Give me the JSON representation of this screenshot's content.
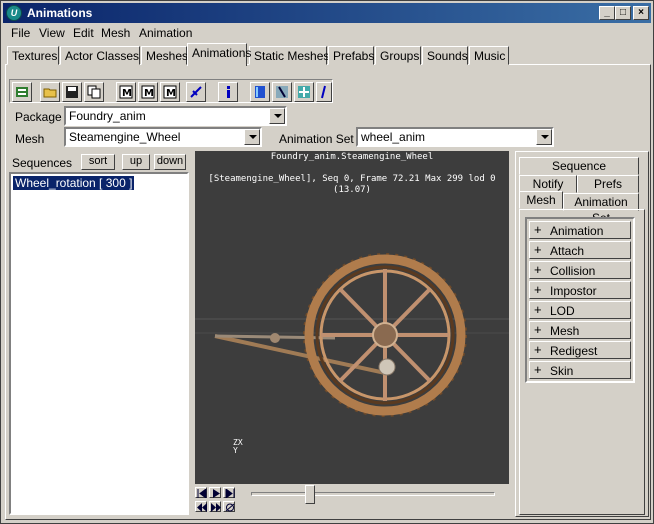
{
  "window": {
    "title": "Animations",
    "minimize": "_",
    "maximize": "□",
    "close": "×"
  },
  "menu": [
    "File",
    "View",
    "Edit",
    "Mesh",
    "Animation"
  ],
  "tabs": [
    "Textures",
    "Actor Classes",
    "Meshes",
    "Animations",
    "Static Meshes",
    "Prefabs",
    "Groups",
    "Sounds",
    "Music"
  ],
  "active_tab": "Animations",
  "toolbar": [
    "load-icon",
    "open-folder-icon",
    "save-icon",
    "copy-icon",
    "mesh-new-icon",
    "mesh-edit-icon",
    "mesh-add-icon",
    "link-icon",
    "info-icon",
    "book-icon",
    "pose-icon",
    "skeleton-icon",
    "figure-icon"
  ],
  "package": {
    "label": "Package",
    "value": "Foundry_anim"
  },
  "mesh": {
    "label": "Mesh",
    "value": "Steamengine_Wheel"
  },
  "animset": {
    "label": "Animation Set",
    "value": "wheel_anim"
  },
  "sequences": {
    "label": "Sequences",
    "sort": "sort",
    "up": "up",
    "down": "down",
    "items": [
      "Wheel_rotation [ 300 ]"
    ]
  },
  "viewport": {
    "title": "Foundry_anim.Steamengine_Wheel",
    "status": "[Steamengine_Wheel], Seq 0,  Frame 72.21 Max 299  lod 0",
    "fps": "(13.07)",
    "axis": "ZX\nY",
    "bg_color": "#3d3d3d"
  },
  "playback": {
    "position": 0.24
  },
  "right_panel": {
    "tabs_row1": [
      "Sequence"
    ],
    "tabs_row2": [
      "Notify",
      "Prefs"
    ],
    "tabs_row3": [
      "Mesh",
      "Animation Set"
    ],
    "active": "Mesh",
    "groups": [
      "Animation",
      "Attach",
      "Collision",
      "Impostor",
      "LOD",
      "Mesh",
      "Redigest",
      "Skin"
    ]
  }
}
